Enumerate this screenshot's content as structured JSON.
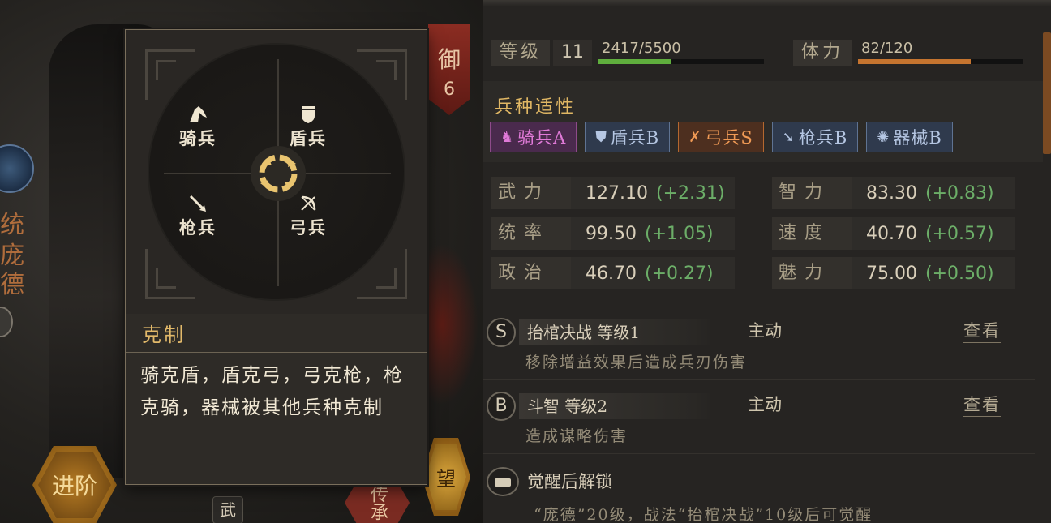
{
  "scene": {
    "side_chars": [
      "统",
      "庞",
      "德"
    ],
    "advance_button": "进阶",
    "hope_button": "望",
    "inherit_button": "传承",
    "wu_tag": "武"
  },
  "banner": {
    "label": "御",
    "value": "6"
  },
  "counter_popup": {
    "units": {
      "cavalry": "骑兵",
      "shield": "盾兵",
      "spear": "枪兵",
      "bow": "弓兵"
    },
    "title": "克制",
    "text": "骑克盾，盾克弓，弓克枪，枪克骑，器械被其他兵种克制"
  },
  "level": {
    "label": "等级",
    "value": "11",
    "exp_text": "2417/5500",
    "exp_progress": 0.44,
    "exp_color": "#5fae3d"
  },
  "stamina": {
    "label": "体力",
    "value_text": "82/120",
    "progress": 0.68,
    "color": "#c5742f"
  },
  "aptitude": {
    "title": "兵种适性",
    "chips": [
      {
        "icon": "horse-icon",
        "glyph": "♞",
        "label": "骑兵A",
        "color": "#e07ad8",
        "bg": "#4a2a4d",
        "border": "#8e4b8a"
      },
      {
        "icon": "shield-icon",
        "glyph": "⛊",
        "label": "盾兵B",
        "color": "#b5c6e2",
        "bg": "#2f3a4d",
        "border": "#5f7392"
      },
      {
        "icon": "bow-icon",
        "glyph": "✗",
        "label": "弓兵S",
        "color": "#f09a55",
        "bg": "#4d2f1f",
        "border": "#b5682f"
      },
      {
        "icon": "spear-icon",
        "glyph": "➘",
        "label": "枪兵B",
        "color": "#b5c6e2",
        "bg": "#2f3a4d",
        "border": "#5f7392"
      },
      {
        "icon": "gear-icon",
        "glyph": "✺",
        "label": "器械B",
        "color": "#b5c6e2",
        "bg": "#2f3a4d",
        "border": "#5f7392"
      }
    ]
  },
  "stats": [
    {
      "name": "武力",
      "value": "127.10",
      "bonus": "(+2.31)"
    },
    {
      "name": "智力",
      "value": "83.30",
      "bonus": "(+0.83)"
    },
    {
      "name": "统率",
      "value": "99.50",
      "bonus": "(+1.05)"
    },
    {
      "name": "速度",
      "value": "40.70",
      "bonus": "(+0.57)"
    },
    {
      "name": "政治",
      "value": "46.70",
      "bonus": "(+0.27)"
    },
    {
      "name": "魅力",
      "value": "75.00",
      "bonus": "(+0.50)"
    }
  ],
  "skills": [
    {
      "grade": "S",
      "name": "抬棺决战 等级1",
      "type": "主动",
      "view": "查看",
      "desc": "移除增益效果后造成兵刃伤害"
    },
    {
      "grade": "B",
      "name": "斗智 等级2",
      "type": "主动",
      "view": "查看",
      "desc": "造成谋略伤害"
    }
  ],
  "awaken": {
    "title": "觉醒后解锁",
    "desc": "“庞德”20级，战法“抬棺决战”10级后可觉醒"
  }
}
